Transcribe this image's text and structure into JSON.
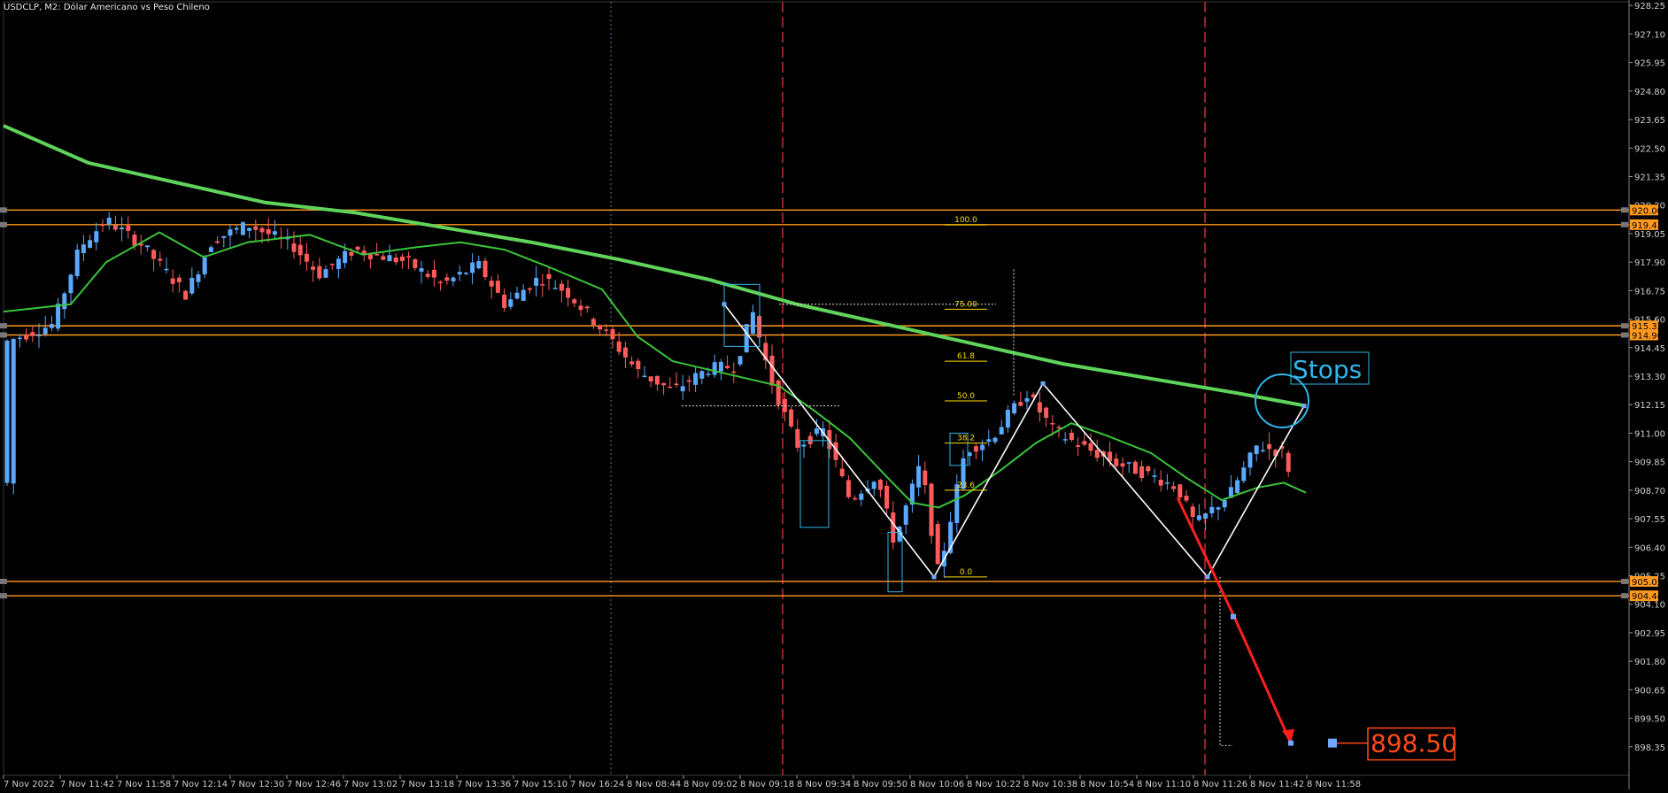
{
  "chart_data": {
    "type": "candlestick",
    "title": "USDCLP, M2:  Dólar Americano vs Peso Chileno",
    "ylim": [
      897.2,
      928.4
    ],
    "y_ticks": [
      "928.25",
      "927.10",
      "925.95",
      "924.80",
      "923.65",
      "922.50",
      "921.35",
      "920.20",
      "919.05",
      "917.90",
      "916.75",
      "915.60",
      "914.45",
      "913.30",
      "912.15",
      "911.00",
      "909.85",
      "908.70",
      "907.55",
      "906.40",
      "905.25",
      "904.10",
      "902.95",
      "901.80",
      "900.65",
      "899.50",
      "898.35"
    ],
    "x_ticks": [
      "7 Nov 2022",
      "7 Nov 11:42",
      "7 Nov 11:58",
      "7 Nov 12:14",
      "7 Nov 12:30",
      "7 Nov 12:46",
      "7 Nov 13:02",
      "7 Nov 13:18",
      "7 Nov 13:36",
      "7 Nov 15:10",
      "7 Nov 16:24",
      "8 Nov 08:44",
      "8 Nov 09:02",
      "8 Nov 09:18",
      "8 Nov 09:34",
      "8 Nov 09:50",
      "8 Nov 10:06",
      "8 Nov 10:22",
      "8 Nov 10:38",
      "8 Nov 10:54",
      "8 Nov 11:10",
      "8 Nov 11:26",
      "8 Nov 11:42",
      "8 Nov 11:58"
    ],
    "horizontal_levels": [
      {
        "value": 920.0,
        "label": "920.00"
      },
      {
        "value": 919.41,
        "label": "919.41"
      },
      {
        "value": 915.33,
        "label": "915.33"
      },
      {
        "value": 914.96,
        "label": "914.96"
      },
      {
        "value": 905.02,
        "label": "905.02"
      },
      {
        "value": 904.44,
        "label": "904.44"
      }
    ],
    "fib_levels": [
      {
        "label": "100.0",
        "value": 919.4
      },
      {
        "label": "75.00",
        "value": 916.0
      },
      {
        "label": "61.8",
        "value": 913.9
      },
      {
        "label": "50.0",
        "value": 912.3
      },
      {
        "label": "38.2",
        "value": 910.6
      },
      {
        "label": "23.6",
        "value": 908.7
      },
      {
        "label": "0.0",
        "value": 905.2
      }
    ],
    "annotations": {
      "stops_label": "Stops",
      "target_label": "898.50",
      "target_value": 898.5
    },
    "series": [
      {
        "name": "",
        "color": "#5fd35a",
        "description": "slow moving average"
      },
      {
        "name": "",
        "color": "#39c43a",
        "description": "fast moving average"
      }
    ],
    "colors": {
      "background": "#000000",
      "bull_candle": "#5aa9ff",
      "bear_candle": "#ff5b5b",
      "level_line": "#ff9a1f",
      "slow_ma": "#5fd35a",
      "fast_ma": "#39c43a",
      "zigzag": "#ffffff",
      "target_arrow": "#ff1f1f",
      "annotation_box": "#31b6ea",
      "fib_text": "#ffde00",
      "vertical_marker": "#d0343a"
    },
    "grid": false
  }
}
